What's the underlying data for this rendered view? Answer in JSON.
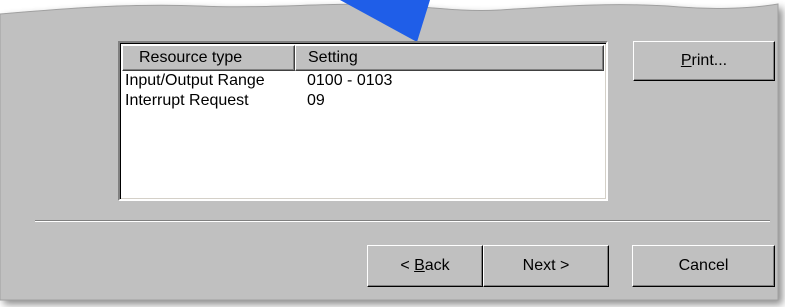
{
  "colors": {
    "dialog_face": "#c0c0c0",
    "list_background": "#ffffff",
    "arrow_blue": "#1f5ee8"
  },
  "listview": {
    "columns": [
      "Resource type",
      "Setting"
    ],
    "rows": [
      [
        "Input/Output Range",
        "0100 - 0103"
      ],
      [
        "Interrupt Request",
        "09"
      ]
    ]
  },
  "buttons": {
    "print": {
      "prefix": "",
      "accel": "P",
      "suffix": "rint..."
    },
    "back": {
      "prefix": "< ",
      "accel": "B",
      "suffix": "ack"
    },
    "next": {
      "label": "Next >"
    },
    "cancel": {
      "label": "Cancel"
    }
  },
  "icons": [
    "arrow-pointer-icon"
  ]
}
